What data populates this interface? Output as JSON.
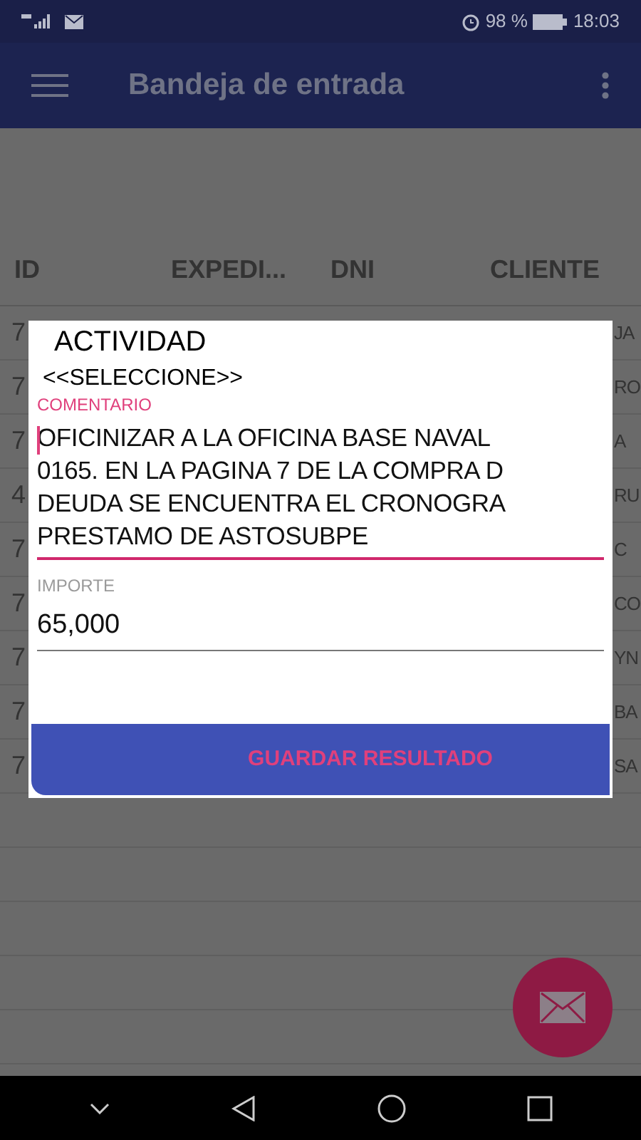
{
  "status_bar": {
    "battery": "98 %",
    "time": "18:03"
  },
  "app_bar": {
    "title": "Bandeja de entrada"
  },
  "table": {
    "columns": [
      "ID",
      "EXPEDI...",
      "DNI",
      "CLIENTE"
    ],
    "rows": [
      {
        "id": "7",
        "cliente": "JA"
      },
      {
        "id": "7",
        "cliente": "RO"
      },
      {
        "id": "7",
        "cliente": "A"
      },
      {
        "id": "4",
        "cliente": "RU"
      },
      {
        "id": "7",
        "cliente": "C"
      },
      {
        "id": "7",
        "cliente": "CO"
      },
      {
        "id": "7",
        "cliente": "YN"
      },
      {
        "id": "7",
        "cliente": "BA"
      },
      {
        "id": "7",
        "cliente": "SA"
      }
    ]
  },
  "dialog": {
    "title": "ACTIVIDAD",
    "select_value": "<<SELECCIONE>>",
    "comment": {
      "label": "COMENTARIO",
      "focused": true,
      "lines": [
        "OFICINIZAR A LA OFICINA BASE NAVAL",
        "0165. EN LA PAGINA 7 DE LA COMPRA D",
        "DEUDA SE ENCUENTRA EL CRONOGRA",
        "PRESTAMO DE ASTOSUBPE"
      ]
    },
    "amount": {
      "label": "IMPORTE",
      "focused": false,
      "value": "65,000"
    },
    "button": "GUARDAR RESULTADO"
  }
}
